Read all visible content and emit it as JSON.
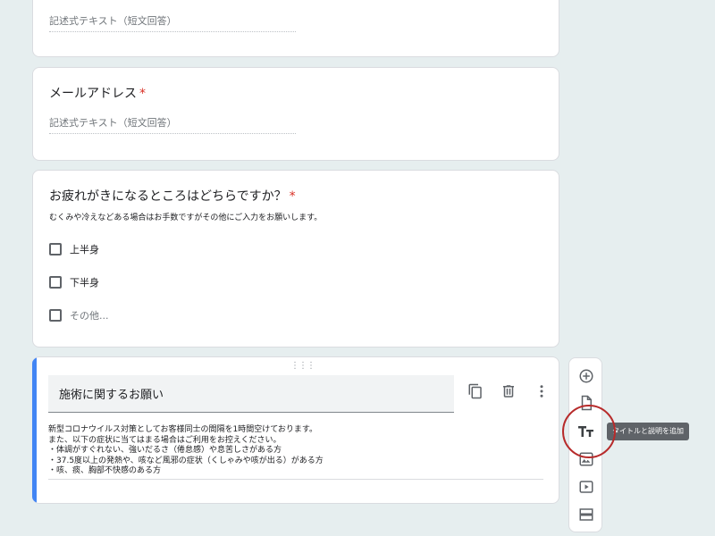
{
  "colors": {
    "accent": "#4285f4",
    "required": "#d93025",
    "annotation": "#b72b2b"
  },
  "card_email_tail": {
    "answer_placeholder": "記述式テキスト（短文回答）"
  },
  "card_email": {
    "title": "メールアドレス",
    "required_mark": "*",
    "answer_placeholder": "記述式テキスト（短文回答）"
  },
  "card_fatigue": {
    "title": "お疲れがきになるところはどちらですか？",
    "required_mark": "*",
    "description": "むくみや冷えなどある場合はお手数ですがその他にご入力をお願いします。",
    "options": [
      {
        "label": "上半身"
      },
      {
        "label": "下半身"
      },
      {
        "label": "その他..."
      }
    ]
  },
  "card_request": {
    "title": "施術に関するお願い",
    "description_lines": [
      "新型コロナウイルス対策としてお客様同士の間隔を1時間空けております。",
      "また、以下の症状に当てはまる場合はご利用をお控えください。",
      "・体調がすぐれない、強いだるさ（倦怠感）や息苦しさがある方",
      "・37.5度以上の発熱や、咳など風邪の症状（くしゃみや咳が出る）がある方",
      "・咳、痰、胸部不快感のある方"
    ],
    "icons": {
      "copy": "copy-icon",
      "delete": "trash-icon",
      "more": "more-vert-icon",
      "drag": "drag-handle-icon"
    }
  },
  "toolbar": {
    "buttons": [
      {
        "name": "add-question",
        "icon": "plus-circle-icon"
      },
      {
        "name": "import-questions",
        "icon": "file-import-icon"
      },
      {
        "name": "add-title-description",
        "icon": "text-tt-icon"
      },
      {
        "name": "add-image",
        "icon": "image-icon"
      },
      {
        "name": "add-video",
        "icon": "video-icon"
      },
      {
        "name": "add-section",
        "icon": "section-icon"
      }
    ],
    "tooltip": "タイトルと説明を追加"
  }
}
